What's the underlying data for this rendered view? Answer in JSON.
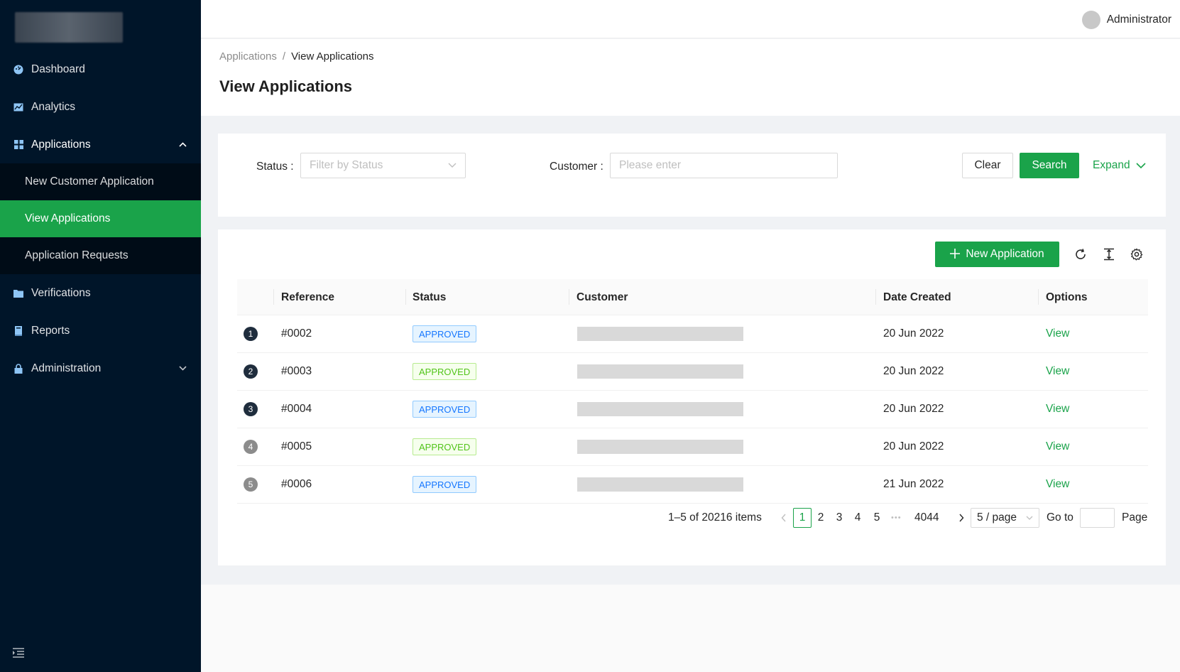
{
  "header": {
    "user_name": "Administrator"
  },
  "sidebar": {
    "items": [
      {
        "label": "Dashboard",
        "icon": "dashboard-icon"
      },
      {
        "label": "Analytics",
        "icon": "chart-icon"
      },
      {
        "label": "Applications",
        "icon": "grid-icon",
        "expanded": true,
        "children": [
          {
            "label": "New Customer Application"
          },
          {
            "label": "View Applications",
            "active": true
          },
          {
            "label": "Application Requests"
          }
        ]
      },
      {
        "label": "Verifications",
        "icon": "folder-icon"
      },
      {
        "label": "Reports",
        "icon": "book-icon"
      },
      {
        "label": "Administration",
        "icon": "lock-icon",
        "expandable": true
      }
    ],
    "colors": {
      "bg": "#001529",
      "active": "#1aa34a"
    }
  },
  "breadcrumb": {
    "parent": "Applications",
    "separator": "/",
    "current": "View Applications"
  },
  "page": {
    "title": "View Applications"
  },
  "filter": {
    "status_label": "Status :",
    "status_placeholder": "Filter by Status",
    "customer_label": "Customer :",
    "customer_placeholder": "Please enter",
    "clear_label": "Clear",
    "search_label": "Search",
    "expand_label": "Expand"
  },
  "toolbar": {
    "new_label": "New Application"
  },
  "table": {
    "columns": [
      "Reference",
      "Status",
      "Customer",
      "Date Created",
      "Options"
    ],
    "rows": [
      {
        "index": "1",
        "reference": "#0002",
        "status": "APPROVED",
        "status_color": "blue",
        "date": "20 Jun 2022",
        "option": "View"
      },
      {
        "index": "2",
        "reference": "#0003",
        "status": "APPROVED",
        "status_color": "green",
        "date": "20 Jun 2022",
        "option": "View"
      },
      {
        "index": "3",
        "reference": "#0004",
        "status": "APPROVED",
        "status_color": "blue",
        "date": "20 Jun 2022",
        "option": "View"
      },
      {
        "index": "4",
        "reference": "#0005",
        "status": "APPROVED",
        "status_color": "green",
        "date": "20 Jun 2022",
        "option": "View"
      },
      {
        "index": "5",
        "reference": "#0006",
        "status": "APPROVED",
        "status_color": "blue",
        "date": "21 Jun 2022",
        "option": "View"
      }
    ]
  },
  "pagination": {
    "summary": "1–5 of 20216 items",
    "pages": [
      "1",
      "2",
      "3",
      "4",
      "5"
    ],
    "current": "1",
    "ellipsis": "•••",
    "last": "4044",
    "page_size": "5 / page",
    "goto_label": "Go to",
    "page_label": "Page"
  },
  "accent_color": "#1aa34a"
}
